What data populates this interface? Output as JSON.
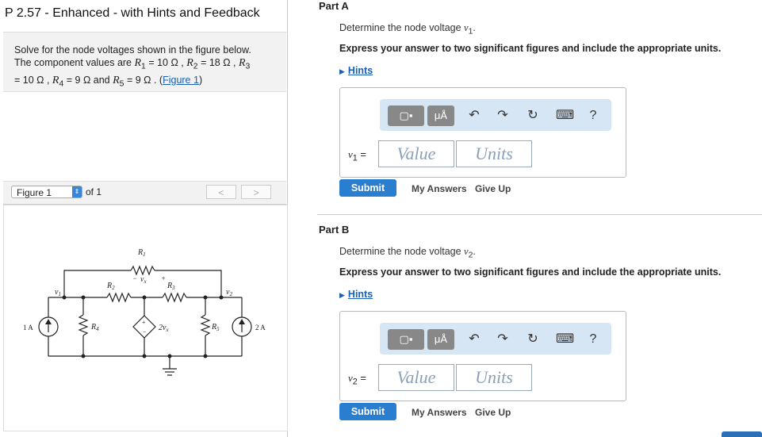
{
  "problem": {
    "title": "P 2.57 - Enhanced - with Hints and Feedback",
    "statement_line1": "Solve for the node voltages shown in the figure below.",
    "statement_line2_prefix": "The component values are ",
    "r1": "R",
    "r1_sub": "1",
    "r1_val": " = 10 Ω , ",
    "r2": "R",
    "r2_sub": "2",
    "r2_val": " = 18 Ω , ",
    "r3": "R",
    "r3_sub": "3",
    "line3_start": "= 10 Ω , ",
    "r4": "R",
    "r4_sub": "4",
    "r4_val": " = 9 Ω and ",
    "r5": "R",
    "r5_sub": "5",
    "r5_val": " = 9 Ω . (",
    "figure_link": "Figure 1",
    "close_paren": ")"
  },
  "figure_nav": {
    "selected": "Figure 1",
    "of_label": "of 1",
    "prev": "<",
    "next": ">"
  },
  "circuit": {
    "r1": "R",
    "r1_sub": "1",
    "r2": "R",
    "r2_sub": "2",
    "r3": "R",
    "r3_sub": "3",
    "r4": "R",
    "r4_sub": "4",
    "r5": "R",
    "r5_sub": "5",
    "v1": "v",
    "v1_sub": "1",
    "v2": "v",
    "v2_sub": "2",
    "vx_minus": "−",
    "vx": "v",
    "vx_sub": "x",
    "vx_plus": "+",
    "src_left": "1 A",
    "src_right": "2 A",
    "dep_label": "2v",
    "dep_sub": "x",
    "dep_plus": "+",
    "dep_minus": "−"
  },
  "partA": {
    "heading": "Part A",
    "question_prefix": "Determine the node voltage ",
    "var": "v",
    "var_sub": "1",
    "question_suffix": ".",
    "instruction": "Express your answer to two significant figures and include the appropriate units.",
    "hints": "Hints",
    "label_var": "v",
    "label_sub": "1",
    "label_eq": " =",
    "value_placeholder": "Value",
    "units_placeholder": "Units",
    "submit": "Submit",
    "my_answers": "My Answers",
    "give_up": "Give Up"
  },
  "partB": {
    "heading": "Part B",
    "question_prefix": "Determine the node voltage ",
    "var": "v",
    "var_sub": "2",
    "question_suffix": ".",
    "instruction": "Express your answer to two significant figures and include the appropriate units.",
    "hints": "Hints",
    "label_var": "v",
    "label_sub": "2",
    "label_eq": " =",
    "value_placeholder": "Value",
    "units_placeholder": "Units",
    "submit": "Submit",
    "my_answers": "My Answers",
    "give_up": "Give Up"
  },
  "toolbar": {
    "units_button": "μÅ",
    "undo_icon": "↶",
    "redo_icon": "↷",
    "reset_icon": "↻",
    "keyboard_icon": "⌨",
    "help": "?"
  }
}
